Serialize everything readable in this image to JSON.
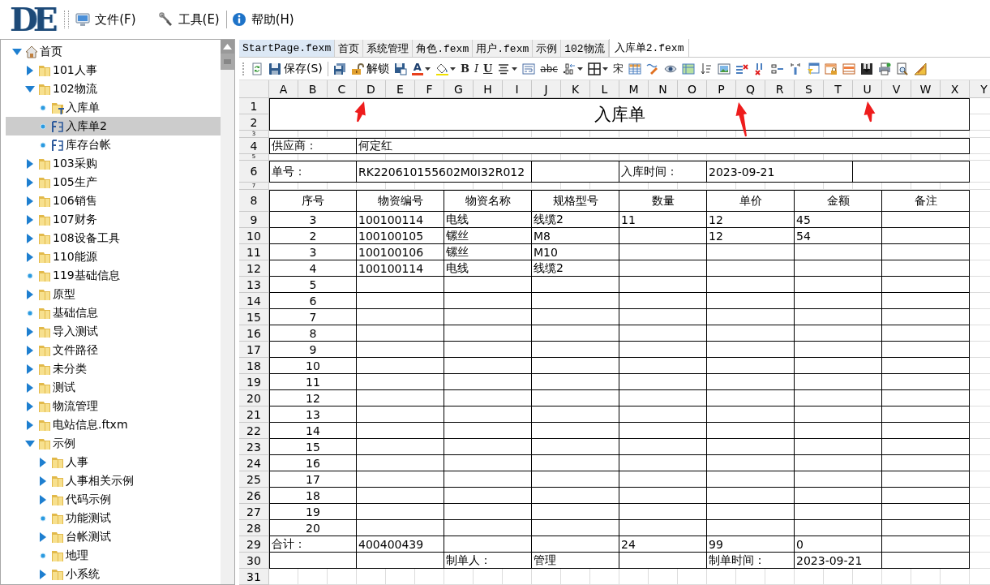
{
  "logo": "DE",
  "menu": [
    {
      "label": "文件(F)",
      "kind": "file"
    },
    {
      "label": "工具(E)",
      "kind": "tools"
    },
    {
      "label": "帮助(H)",
      "kind": "help"
    }
  ],
  "tree": [
    {
      "label": "首页",
      "kind": "home",
      "leaf": false,
      "expanded": true,
      "selected": false,
      "children": [
        {
          "label": "101人事",
          "kind": "folder",
          "leaf": false,
          "expanded": false,
          "selected": false
        },
        {
          "label": "102物流",
          "kind": "folder",
          "leaf": false,
          "expanded": true,
          "selected": false,
          "children": [
            {
              "label": "入库单",
              "kind": "form-folder",
              "leaf": true,
              "selected": false
            },
            {
              "label": "入库单2",
              "kind": "form",
              "leaf": true,
              "selected": true
            },
            {
              "label": "库存台帐",
              "kind": "form",
              "leaf": true,
              "selected": false
            }
          ]
        },
        {
          "label": "103采购",
          "kind": "folder",
          "leaf": false,
          "expanded": false,
          "selected": false
        },
        {
          "label": "105生产",
          "kind": "folder",
          "leaf": false,
          "expanded": false,
          "selected": false
        },
        {
          "label": "106销售",
          "kind": "folder",
          "leaf": false,
          "expanded": false,
          "selected": false
        },
        {
          "label": "107财务",
          "kind": "folder",
          "leaf": false,
          "expanded": false,
          "selected": false
        },
        {
          "label": "108设备工具",
          "kind": "folder",
          "leaf": false,
          "expanded": false,
          "selected": false
        },
        {
          "label": "110能源",
          "kind": "folder",
          "leaf": false,
          "expanded": false,
          "selected": false
        },
        {
          "label": "119基础信息",
          "kind": "folder",
          "leaf": true,
          "selected": false
        },
        {
          "label": "原型",
          "kind": "folder",
          "leaf": false,
          "expanded": false,
          "selected": false
        },
        {
          "label": "基础信息",
          "kind": "folder",
          "leaf": true,
          "selected": false
        },
        {
          "label": "导入测试",
          "kind": "folder",
          "leaf": false,
          "expanded": false,
          "selected": false
        },
        {
          "label": "文件路径",
          "kind": "folder",
          "leaf": false,
          "expanded": false,
          "selected": false
        },
        {
          "label": "未分类",
          "kind": "folder",
          "leaf": false,
          "expanded": false,
          "selected": false
        },
        {
          "label": "测试",
          "kind": "folder",
          "leaf": false,
          "expanded": false,
          "selected": false
        },
        {
          "label": "物流管理",
          "kind": "folder",
          "leaf": false,
          "expanded": false,
          "selected": false
        },
        {
          "label": "电站信息.ftxm",
          "kind": "folder",
          "leaf": false,
          "expanded": false,
          "selected": false
        },
        {
          "label": "示例",
          "kind": "folder",
          "leaf": false,
          "expanded": true,
          "selected": false,
          "children": [
            {
              "label": "人事",
              "kind": "folder",
              "leaf": false,
              "expanded": false,
              "selected": false
            },
            {
              "label": "人事相关示例",
              "kind": "folder",
              "leaf": false,
              "expanded": false,
              "selected": false
            },
            {
              "label": "代码示例",
              "kind": "folder",
              "leaf": false,
              "expanded": false,
              "selected": false
            },
            {
              "label": "功能测试",
              "kind": "folder",
              "leaf": true,
              "selected": false
            },
            {
              "label": "台帐测试",
              "kind": "folder",
              "leaf": false,
              "expanded": false,
              "selected": false
            },
            {
              "label": "地理",
              "kind": "folder",
              "leaf": true,
              "selected": false
            },
            {
              "label": "小系统",
              "kind": "folder",
              "leaf": false,
              "expanded": false,
              "selected": false
            }
          ]
        }
      ]
    }
  ],
  "tabs": [
    {
      "label": "StartPage.fexm",
      "selected": false
    },
    {
      "label": "首页",
      "selected": false
    },
    {
      "label": "系统管理",
      "selected": false
    },
    {
      "label": "角色.fexm",
      "selected": false
    },
    {
      "label": "用户.fexm",
      "selected": false
    },
    {
      "label": "示例",
      "selected": false
    },
    {
      "label": "102物流",
      "selected": false
    },
    {
      "label": "入库单2.fexm",
      "selected": true
    }
  ],
  "toolbar": {
    "save": "保存(S)",
    "unlock": "解锁",
    "font_color": "A",
    "bold": "B",
    "italic": "I",
    "underline": "U",
    "strike": "abc",
    "font": "宋"
  },
  "sheet": {
    "columns": [
      "A",
      "B",
      "C",
      "D",
      "E",
      "F",
      "G",
      "H",
      "I",
      "J",
      "K",
      "L",
      "M",
      "N",
      "O",
      "P",
      "Q",
      "R",
      "S",
      "T",
      "U",
      "V",
      "W",
      "X",
      "Y"
    ],
    "rows": [
      "1",
      "2",
      "3",
      "4",
      "5",
      "6",
      "7",
      "8",
      "9",
      "10",
      "11",
      "12",
      "13",
      "14",
      "15",
      "16",
      "17",
      "18",
      "19",
      "20",
      "21",
      "22",
      "23",
      "24",
      "25",
      "26",
      "27",
      "28",
      "29",
      "30",
      "31"
    ]
  },
  "form": {
    "title": "入库单",
    "supplier_label": "供应商：",
    "supplier": "何定红",
    "order_no_label": "单号：",
    "order_no": "RK220610155602M0I32R012",
    "date_label": "入库时间：",
    "date": "2023-09-21",
    "columns": [
      "序号",
      "物资编号",
      "物资名称",
      "规格型号",
      "数量",
      "单价",
      "金额",
      "备注"
    ],
    "items": [
      {
        "no": "3",
        "code": "100100114",
        "name": "电线",
        "spec": "线缆2",
        "qty": "11",
        "price": "12",
        "amount": "45"
      },
      {
        "no": "2",
        "code": "100100105",
        "name": "镙丝",
        "spec": "M8",
        "price": "12",
        "amount": "54"
      },
      {
        "no": "3",
        "code": "100100106",
        "name": "镙丝",
        "spec": "M10"
      },
      {
        "no": "4",
        "code": "100100114",
        "name": "电线",
        "spec": "线缆2"
      },
      {
        "no": "5"
      },
      {
        "no": "6"
      },
      {
        "no": "7"
      },
      {
        "no": "8"
      },
      {
        "no": "9"
      },
      {
        "no": "10"
      },
      {
        "no": "11"
      },
      {
        "no": "12"
      },
      {
        "no": "13"
      },
      {
        "no": "14"
      },
      {
        "no": "15"
      },
      {
        "no": "16"
      },
      {
        "no": "17"
      },
      {
        "no": "18"
      },
      {
        "no": "19"
      },
      {
        "no": "20"
      }
    ],
    "totals": {
      "label": "合计：",
      "code": "400400439",
      "qty": "24",
      "price": "99",
      "amount": "0"
    },
    "footer": {
      "maker_label": "制单人：",
      "maker": "管理",
      "time_label": "制单时间：",
      "time": "2023-09-21"
    }
  }
}
